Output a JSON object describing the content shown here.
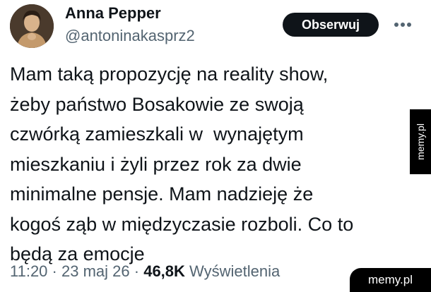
{
  "author": {
    "name": "Anna Pepper",
    "handle": "@antoninakasprz2",
    "avatar": "avatar-photo"
  },
  "actions": {
    "follow_label": "Obserwuj",
    "more_icon": "more-dots-icon"
  },
  "tweet": {
    "lines": [
      "Mam taką propozycję na reality show,",
      "żeby państwo Bosakowie ze swoją",
      "czwórką zamieszkali w  wynajętym",
      "mieszkaniu i żyli przez rok za dwie",
      "minimalne pensje. Mam nadzieję że",
      "kogoś ząb w międzyczasie rozboli. Co to",
      "będą za emocje"
    ]
  },
  "meta": {
    "time": "11:20",
    "separator": "·",
    "date": "23 maj 26",
    "views_count": "46,8K",
    "views_label": "Wyświetlenia"
  },
  "watermarks": {
    "side": "memy.pl",
    "corner": "memy.pl"
  },
  "colors": {
    "text": "#0f1419",
    "secondary": "#536471",
    "button_bg": "#0f1419",
    "watermark_bg": "#000000"
  }
}
